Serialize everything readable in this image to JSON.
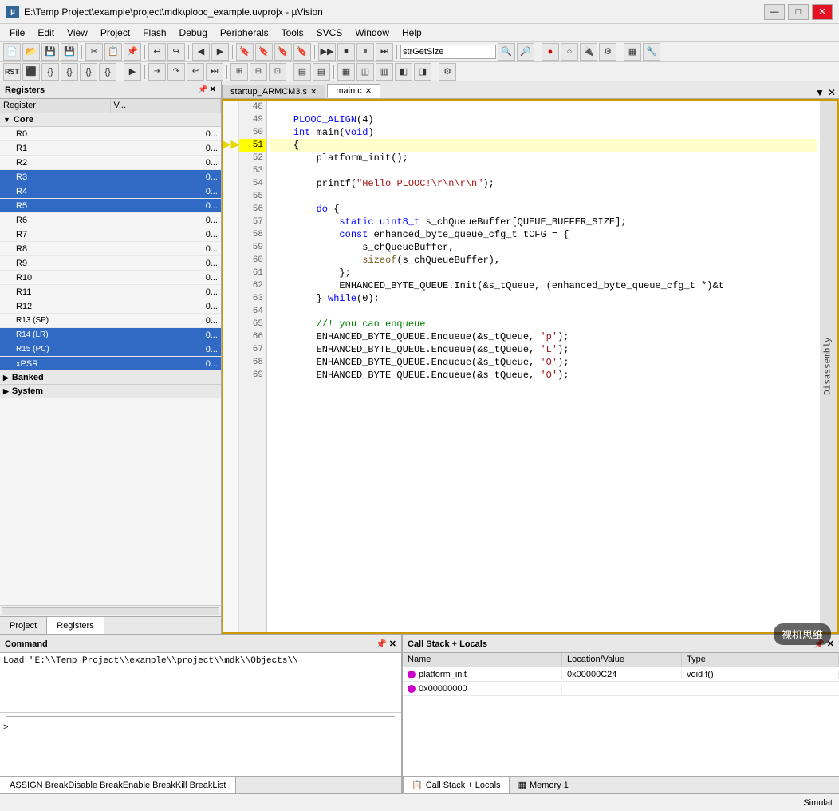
{
  "titleBar": {
    "title": "E:\\Temp Project\\example\\project\\mdk\\plooc_example.uvprojx - µVision",
    "logoText": "µ"
  },
  "menuBar": {
    "items": [
      "File",
      "Edit",
      "View",
      "Project",
      "Flash",
      "Debug",
      "Peripherals",
      "Tools",
      "SVCS",
      "Window",
      "Help"
    ]
  },
  "toolbar1": {
    "searchPlaceholder": "strGetSize"
  },
  "leftPanel": {
    "title": "Registers",
    "columnHeaders": [
      "Register",
      "V..."
    ],
    "groups": [
      {
        "name": "Core",
        "expanded": true,
        "registers": [
          {
            "name": "R0",
            "value": "0...",
            "selected": false
          },
          {
            "name": "R1",
            "value": "0...",
            "selected": false
          },
          {
            "name": "R2",
            "value": "0...",
            "selected": false
          },
          {
            "name": "R3",
            "value": "0...",
            "selected": true
          },
          {
            "name": "R4",
            "value": "0...",
            "selected": true
          },
          {
            "name": "R5",
            "value": "0...",
            "selected": true
          },
          {
            "name": "R6",
            "value": "0...",
            "selected": false
          },
          {
            "name": "R7",
            "value": "0...",
            "selected": false
          },
          {
            "name": "R8",
            "value": "0...",
            "selected": false
          },
          {
            "name": "R9",
            "value": "0...",
            "selected": false
          },
          {
            "name": "R10",
            "value": "0...",
            "selected": false
          },
          {
            "name": "R11",
            "value": "0...",
            "selected": false
          },
          {
            "name": "R12",
            "value": "0...",
            "selected": false
          },
          {
            "name": "R13 (SP)",
            "value": "0...",
            "selected": false
          },
          {
            "name": "R14 (LR)",
            "value": "0...",
            "selected": true
          },
          {
            "name": "R15 (PC)",
            "value": "0...",
            "selected": true
          },
          {
            "name": "xPSR",
            "value": "0...",
            "selected": true
          }
        ]
      },
      {
        "name": "Banked",
        "expanded": false,
        "registers": []
      },
      {
        "name": "System",
        "expanded": false,
        "registers": []
      }
    ]
  },
  "leftTabs": [
    "Project",
    "Registers"
  ],
  "activeLeftTab": "Registers",
  "codeTabs": [
    {
      "label": "startup_ARMCM3.s",
      "active": false
    },
    {
      "label": "main.c",
      "active": true
    }
  ],
  "codeLines": [
    {
      "num": 48,
      "content": "",
      "isArrow": false
    },
    {
      "num": 49,
      "content": "    PLOOC_ALIGN(4)",
      "isArrow": false
    },
    {
      "num": 50,
      "content": "    int main(void)",
      "isArrow": false
    },
    {
      "num": 51,
      "content": "    {",
      "isArrow": true
    },
    {
      "num": 52,
      "content": "        platform_init();",
      "isArrow": false
    },
    {
      "num": 53,
      "content": "",
      "isArrow": false
    },
    {
      "num": 54,
      "content": "        printf(\"Hello PLOOC!\\r\\n\\r\\n\");",
      "isArrow": false
    },
    {
      "num": 55,
      "content": "",
      "isArrow": false
    },
    {
      "num": 56,
      "content": "        do {",
      "isArrow": false
    },
    {
      "num": 57,
      "content": "            static uint8_t s_chQueueBuffer[QUEUE_BUFFER_SIZE];",
      "isArrow": false
    },
    {
      "num": 58,
      "content": "            const enhanced_byte_queue_cfg_t tCFG = {",
      "isArrow": false
    },
    {
      "num": 59,
      "content": "                s_chQueueBuffer,",
      "isArrow": false
    },
    {
      "num": 60,
      "content": "                sizeof(s_chQueueBuffer),",
      "isArrow": false
    },
    {
      "num": 61,
      "content": "            };",
      "isArrow": false
    },
    {
      "num": 62,
      "content": "            ENHANCED_BYTE_QUEUE.Init(&s_tQueue, (enhanced_byte_queue_cfg_t *)&t",
      "isArrow": false
    },
    {
      "num": 63,
      "content": "        } while(0);",
      "isArrow": false
    },
    {
      "num": 64,
      "content": "",
      "isArrow": false
    },
    {
      "num": 65,
      "content": "        //! you can enqueue",
      "isArrow": false
    },
    {
      "num": 66,
      "content": "        ENHANCED_BYTE_QUEUE.Enqueue(&s_tQueue, 'p');",
      "isArrow": false
    },
    {
      "num": 67,
      "content": "        ENHANCED_BYTE_QUEUE.Enqueue(&s_tQueue, 'L');",
      "isArrow": false
    },
    {
      "num": 68,
      "content": "        ENHANCED_BYTE_QUEUE.Enqueue(&s_tQueue, 'O');",
      "isArrow": false
    },
    {
      "num": 69,
      "content": "        ENHANCED_BYTE_QUEUE.Enqueue(&s_tQueue, 'O');",
      "isArrow": false
    }
  ],
  "commandPanel": {
    "title": "Command",
    "loadText": "Load \"E:\\\\Temp Project\\\\example\\\\project\\\\mdk\\\\Objects\\\\",
    "assignText": "ASSIGN BreakDisable BreakEnable BreakKill BreakList",
    "promptSymbol": ">"
  },
  "callStackPanel": {
    "title": "Call Stack + Locals",
    "columns": [
      "Name",
      "Location/Value",
      "Type"
    ],
    "rows": [
      {
        "icon": true,
        "name": "platform_init",
        "location": "0x00000C24",
        "type": "void f()"
      },
      {
        "icon": true,
        "name": "0x00000000",
        "location": "",
        "type": ""
      }
    ]
  },
  "callStackTabs": [
    "Call Stack + Locals",
    "Memory 1"
  ],
  "statusBar": {
    "text": "Simulat"
  },
  "disassembly": {
    "label": "Disassembly"
  },
  "windowControls": {
    "minimize": "—",
    "maximize": "□",
    "close": "✕"
  }
}
